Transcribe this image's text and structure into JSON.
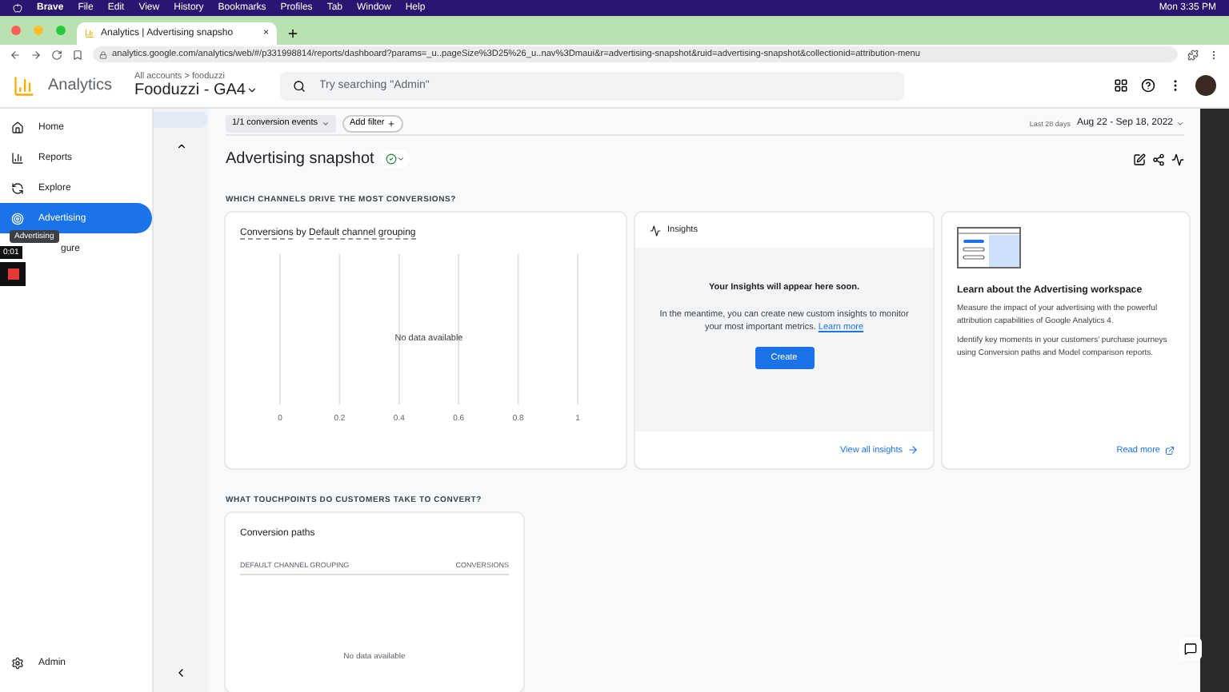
{
  "menubar": {
    "items": [
      "Brave",
      "File",
      "Edit",
      "View",
      "History",
      "Bookmarks",
      "Profiles",
      "Tab",
      "Window",
      "Help"
    ],
    "clock": "Mon 3:35 PM"
  },
  "browser_tab": {
    "title": "Analytics | Advertising snapsho",
    "close": "×"
  },
  "address": "analytics.google.com/analytics/web/#/p331998814/reports/dashboard?params=_u..pageSize%3D25%26_u..nav%3Dmaui&r=advertising-snapshot&ruid=advertising-snapshot&collectionid=attribution-menu",
  "header": {
    "product": "Analytics",
    "breadcrumb": "All accounts > fooduzzi",
    "property": "Fooduzzi - GA4",
    "search_placeholder": "Try searching \"Admin\""
  },
  "nav": [
    {
      "label": "Home",
      "selected": false
    },
    {
      "label": "Reports",
      "selected": false
    },
    {
      "label": "Explore",
      "selected": false
    },
    {
      "label": "Advertising",
      "selected": true
    },
    {
      "label": "gure",
      "selected": false
    }
  ],
  "tooltip": "Advertising",
  "recorder": {
    "time": "0:01"
  },
  "admin": "Admin",
  "filters": {
    "conversion": "1/1 conversion events",
    "add_filter": "Add filter"
  },
  "date": {
    "label": "Last 28 days",
    "range": "Aug 22 - Sep 18, 2022"
  },
  "title": "Advertising snapshot",
  "section1": "WHICH CHANNELS DRIVE THE MOST CONVERSIONS?",
  "channel_card": {
    "metric": "Conversions",
    "joiner": "by",
    "dimension": "Default channel grouping",
    "empty": "No data available",
    "axis_labels": [
      "0",
      "0.2",
      "0.4",
      "0.6",
      "0.8",
      "1"
    ]
  },
  "insights": {
    "title": "Insights",
    "headline": "Your Insights will appear here soon.",
    "body": "In the meantime, you can create new custom insights to monitor your most important metrics.",
    "link": "Learn more",
    "button": "Create",
    "footer": "View all insights"
  },
  "learn": {
    "title": "Learn about the Advertising workspace",
    "paragraphs": [
      "Measure the impact of your advertising with the powerful attribution capabilities of Google Analytics 4.",
      "Identify key moments in your customers' purchase journeys using Conversion paths and Model comparison reports."
    ],
    "link": "Read more"
  },
  "section2": "WHAT TOUCHPOINTS DO CUSTOMERS TAKE TO CONVERT?",
  "paths": {
    "title": "Conversion paths",
    "columns": [
      "DEFAULT CHANNEL GROUPING",
      "CONVERSIONS"
    ],
    "empty": "No data available"
  }
}
